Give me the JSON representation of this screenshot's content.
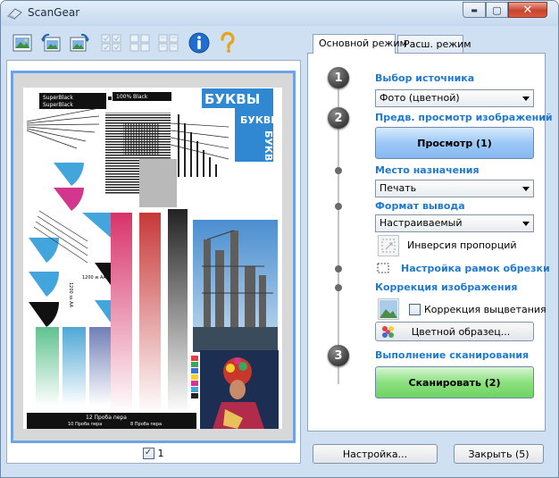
{
  "window": {
    "title": "ScanGear",
    "min_glyph": "▬",
    "max_glyph": "▢",
    "close_glyph": "✕"
  },
  "toolbar": {
    "icons": [
      "scanner-photo-icon",
      "rotate-left-icon",
      "rotate-right-icon",
      "thumbnail-view-icon",
      "whole-image-view-icon",
      "multi-crop-icon",
      "info-icon",
      "help-icon"
    ]
  },
  "preview": {
    "page_number": "1",
    "check_mark": "✓"
  },
  "tabs": {
    "basic": "Основной режим",
    "advanced": "Расш. режим"
  },
  "panel": {
    "step1": {
      "number": "1",
      "label": "Выбор источника",
      "value": "Фото (цветной)"
    },
    "step2": {
      "number": "2",
      "label": "Предв. просмотр изображений",
      "button": "Просмотр (1)"
    },
    "destination": {
      "label": "Место назначения",
      "value": "Печать"
    },
    "output_size": {
      "label": "Формат вывода",
      "value": "Настраиваемый",
      "invert_label": "Инверсия пропорций"
    },
    "crop_frame": {
      "label": "Настройка рамок обрезки"
    },
    "correction": {
      "label": "Коррекция изображения",
      "fading_label": "Коррекция выцветания",
      "color_pattern_button": "Цветной образец..."
    },
    "step3": {
      "number": "3",
      "label": "Выполнение сканирования",
      "button": "Сканировать (2)"
    }
  },
  "footer": {
    "settings_button": "Настройка...",
    "close_button": "Закрыть (5)"
  },
  "chart_page": {
    "banner_black1": "SuperBlack",
    "banner_black2": "SuperBlack",
    "banner_black3": "100% Black",
    "title_blue": "БУКВЫ",
    "title_blue2": "БУКВЫ",
    "vertical_text": "БУКВЫ",
    "res_label": "1200 w AA",
    "res_vertical": "1200 ss AA",
    "proof1": "12 Проба пера",
    "proof2": "10 Проба пера",
    "proof3": "8 Проба пера"
  }
}
